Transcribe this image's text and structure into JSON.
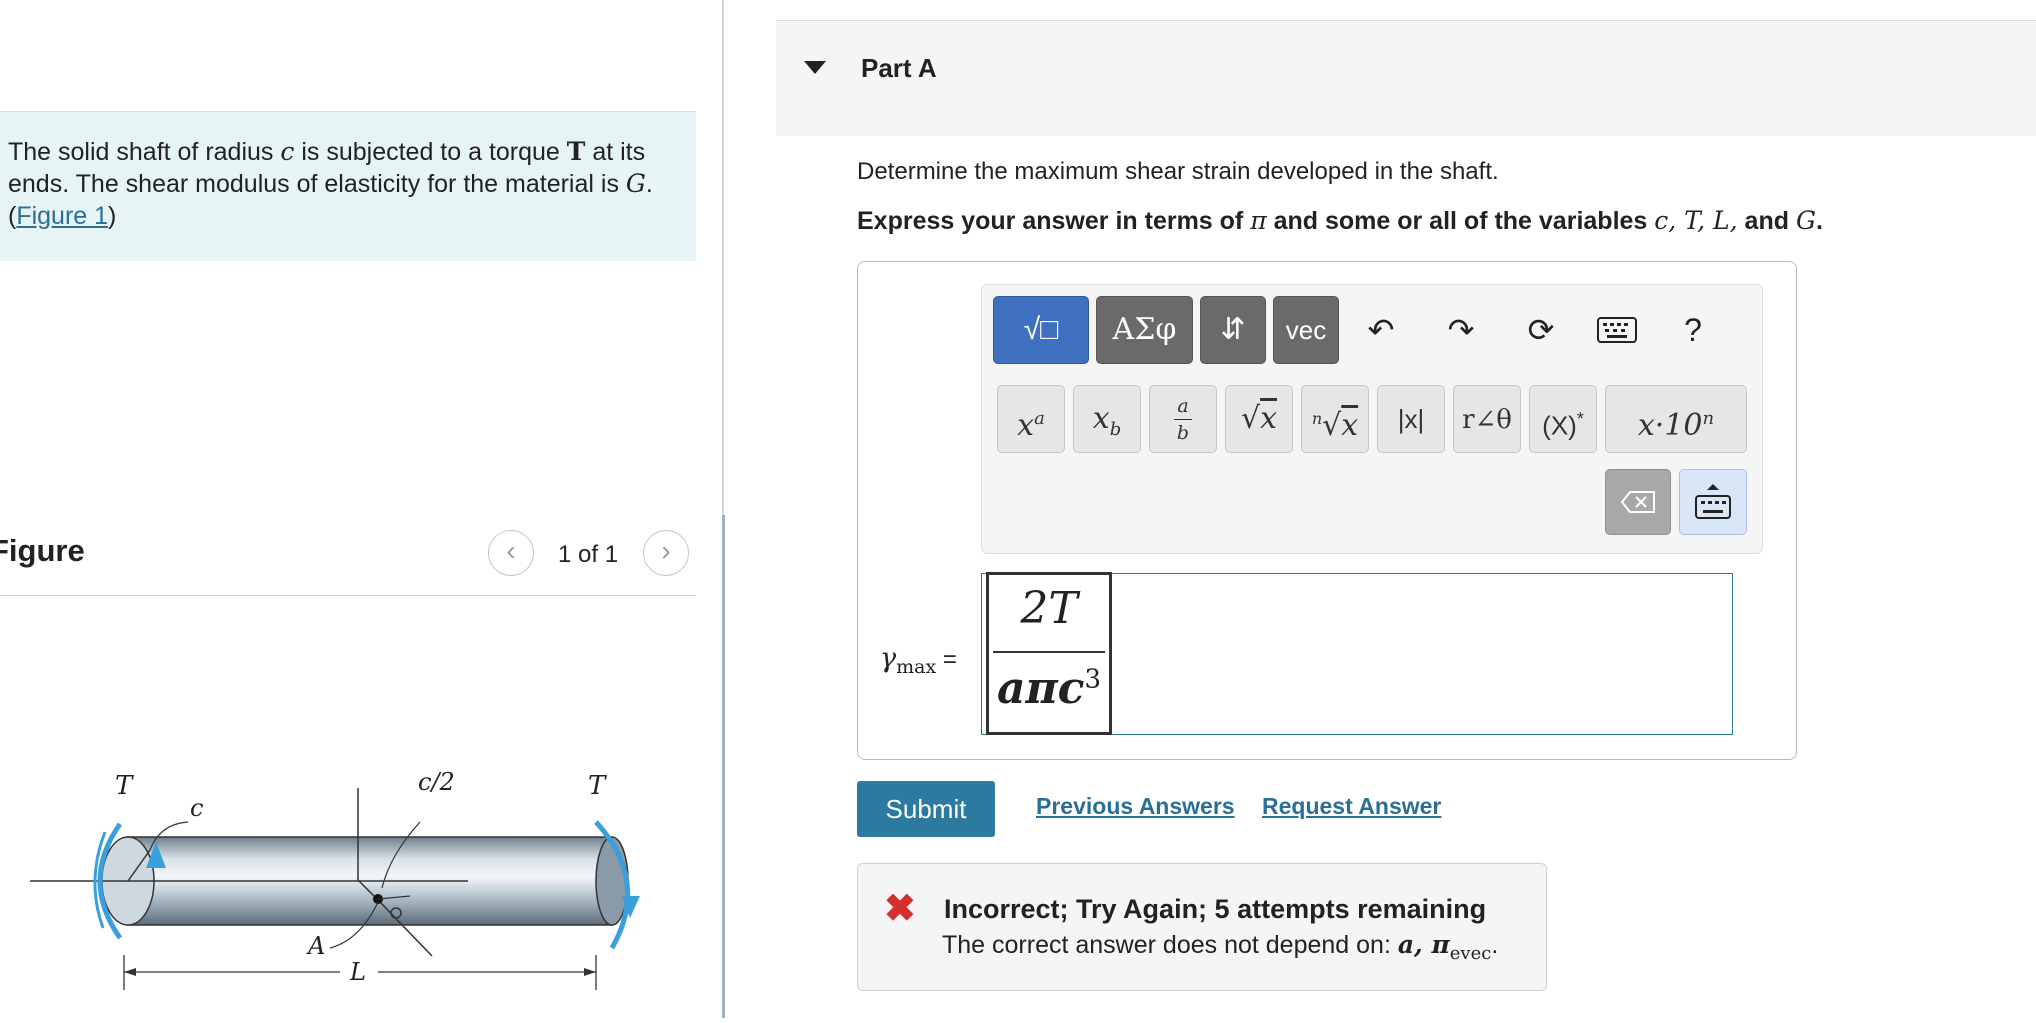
{
  "problem": {
    "text_1": "The solid shaft of radius ",
    "var_c": "c",
    "text_2": " is subjected to a torque ",
    "var_T": "T",
    "text_3": " at its ends. The shear modulus of elasticity for the material is ",
    "var_G": "G",
    "text_4": ". (",
    "figure_link": "Figure 1",
    "text_5": ")"
  },
  "figure": {
    "title": "Figure",
    "count": "1 of 1",
    "prev_icon": "chevron-left-icon",
    "next_icon": "chevron-right-icon",
    "labels": {
      "T_left": "T",
      "c": "c",
      "c_half": "c/2",
      "T_right": "T",
      "A": "A",
      "L": "L"
    }
  },
  "part": {
    "title": "Part A"
  },
  "question": {
    "prompt": "Determine the maximum shear strain developed in the shaft.",
    "instruction_prefix": "Express your answer in terms of ",
    "instruction_pi": "π",
    "instruction_middle": " and some or all of the variables ",
    "instruction_vars": "c, T, L,",
    "instruction_and": " and ",
    "instruction_last_var": "G",
    "instruction_end": "."
  },
  "toolbar": {
    "templates_label": "√□",
    "greek_label": "ΑΣφ",
    "arrows_label": "⇵",
    "vec_label": "vec",
    "undo_icon": "undo-icon",
    "redo_icon": "redo-icon",
    "reset_icon": "reset-icon",
    "keyboard_icon": "keyboard-icon",
    "help_label": "?",
    "keys": [
      "xa",
      "xb",
      "a/b",
      "√x",
      "n√x",
      "|x|",
      "r∠θ",
      "(X)*",
      "x·10n"
    ],
    "backspace_icon": "backspace-icon",
    "keyboard_toggle_icon": "keyboard-toggle-icon"
  },
  "answer": {
    "label_var": "γ",
    "label_sub": "max",
    "label_eq": " =",
    "numerator": "2T",
    "denominator_a": "aπc",
    "denominator_exp": "3"
  },
  "actions": {
    "submit": "Submit",
    "previous_answers": "Previous Answers",
    "request_answer": "Request Answer"
  },
  "feedback": {
    "title": "Incorrect; Try Again; 5 attempts remaining",
    "message_prefix": "The correct answer does not depend on: ",
    "message_vars": "a, π",
    "message_sub": "evec",
    "message_end": ".",
    "icon": "error-x-icon"
  },
  "colors": {
    "problem_bg": "#e7f4f6",
    "link": "#2a6f97",
    "submit_bg": "#2c7aa0",
    "error": "#d32f2f",
    "shaft_blue": "#3a9fdc"
  }
}
